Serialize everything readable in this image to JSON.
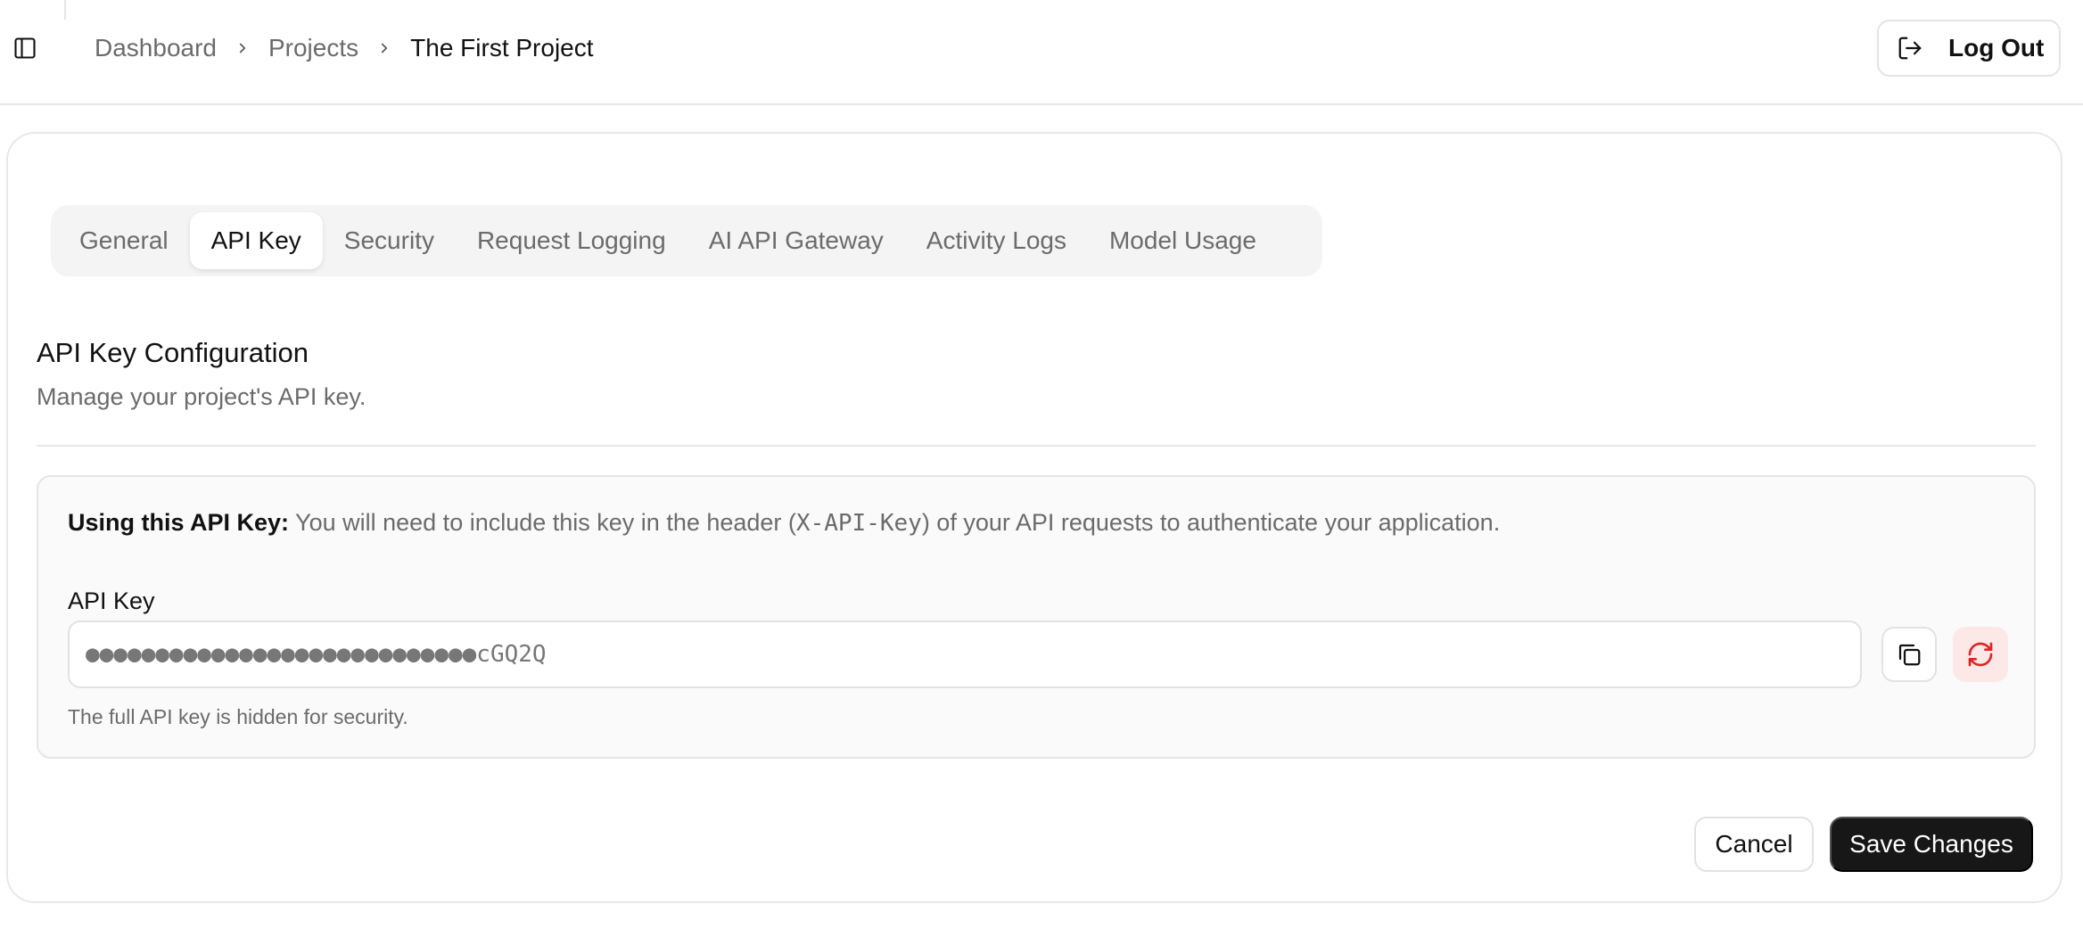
{
  "header": {
    "breadcrumb": [
      "Dashboard",
      "Projects",
      "The First Project"
    ],
    "logout_label": "Log Out"
  },
  "tabs": [
    {
      "label": "General",
      "active": false
    },
    {
      "label": "API Key",
      "active": true
    },
    {
      "label": "Security",
      "active": false
    },
    {
      "label": "Request Logging",
      "active": false
    },
    {
      "label": "AI API Gateway",
      "active": false
    },
    {
      "label": "Activity Logs",
      "active": false
    },
    {
      "label": "Model Usage",
      "active": false
    }
  ],
  "section": {
    "title": "API Key Configuration",
    "subtitle": "Manage your project's API key."
  },
  "notice": {
    "strong": "Using this API Key:",
    "text_before": " You will need to include this key in the header (",
    "code": "X-API-Key",
    "text_after": ") of your API requests to authenticate your application."
  },
  "api_key": {
    "label": "API Key",
    "masked_value": "●●●●●●●●●●●●●●●●●●●●●●●●●●●●cGQ2Q",
    "hint": "The full API key is hidden for security."
  },
  "actions": {
    "cancel_label": "Cancel",
    "save_label": "Save Changes"
  },
  "colors": {
    "primary_button": "#171717",
    "danger_icon": "#dc2626",
    "danger_bg": "#fde8e8"
  },
  "icons": {
    "sidebar_toggle": "panel-left-icon",
    "logout": "log-out-icon",
    "copy": "copy-icon",
    "regenerate": "refresh-icon"
  }
}
